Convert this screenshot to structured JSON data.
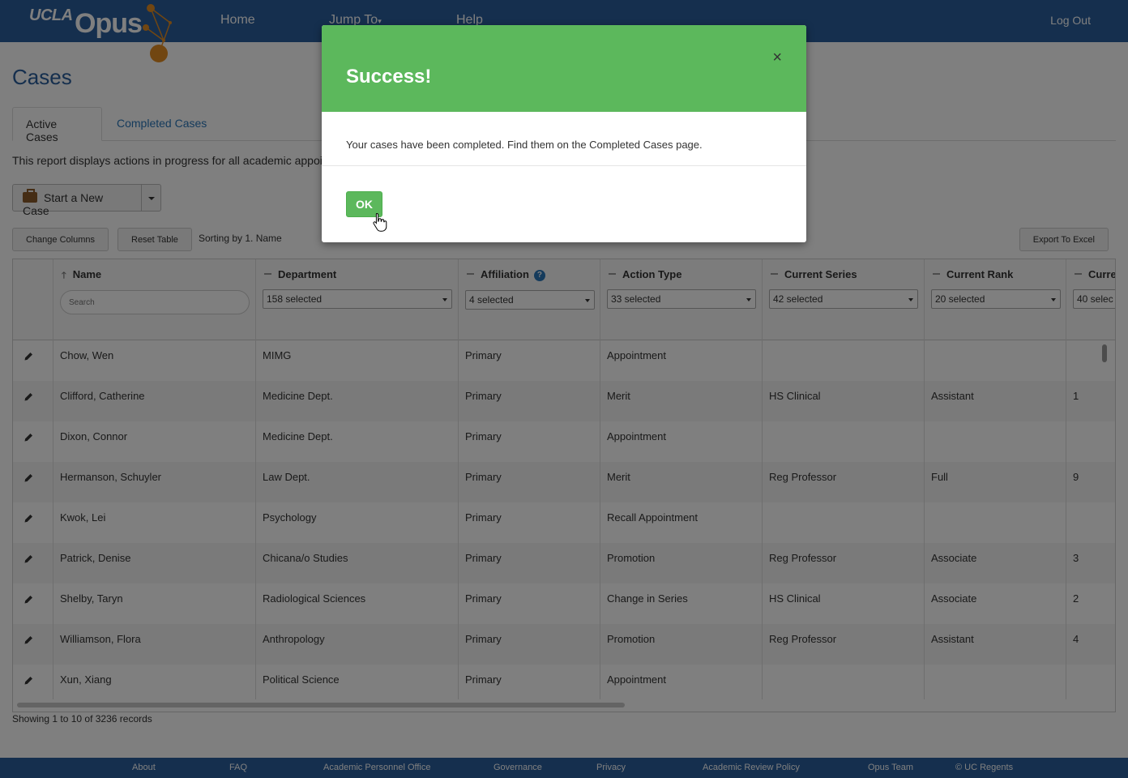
{
  "header": {
    "logo_ucla": "UCLA",
    "logo_opus": "Opus",
    "nav": {
      "home": "Home",
      "jump_to": "Jump To",
      "help": "Help"
    },
    "logout": "Log Out"
  },
  "page": {
    "title": "Cases",
    "tabs": [
      {
        "label": "Active Cases",
        "active": true
      },
      {
        "label": "Completed Cases",
        "active": false
      }
    ],
    "description": "This report displays actions in progress for all academic appoir",
    "start_case_label": "Start a New Case",
    "change_columns_label": "Change Columns",
    "reset_table_label": "Reset Table",
    "sorting_text": "Sorting by 1. Name",
    "export_label": "Export To Excel"
  },
  "table": {
    "columns": [
      {
        "label": "Name",
        "filter_placeholder": "Search"
      },
      {
        "label": "Department",
        "filter": "158 selected"
      },
      {
        "label": "Affiliation",
        "filter": "4 selected"
      },
      {
        "label": "Action Type",
        "filter": "33 selected"
      },
      {
        "label": "Current Series",
        "filter": "42 selected"
      },
      {
        "label": "Current Rank",
        "filter": "20 selected"
      },
      {
        "label": "Curre",
        "filter": "40 selec"
      }
    ],
    "rows": [
      [
        "Chow, Wen",
        "MIMG",
        "Primary",
        "Appointment",
        "",
        "",
        ""
      ],
      [
        "Clifford, Catherine",
        "Medicine Dept.",
        "Primary",
        "Merit",
        "HS Clinical",
        "Assistant",
        "1"
      ],
      [
        "Dixon, Connor",
        "Medicine Dept.",
        "Primary",
        "Appointment",
        "",
        "",
        ""
      ],
      [
        "Hermanson, Schuyler",
        "Law Dept.",
        "Primary",
        "Merit",
        "Reg Professor",
        "Full",
        "9"
      ],
      [
        "Kwok, Lei",
        "Psychology",
        "Primary",
        "Recall Appointment",
        "",
        "",
        ""
      ],
      [
        "Patrick, Denise",
        "Chicana/o Studies",
        "Primary",
        "Promotion",
        "Reg Professor",
        "Associate",
        "3"
      ],
      [
        "Shelby, Taryn",
        "Radiological Sciences",
        "Primary",
        "Change in Series",
        "HS Clinical",
        "Associate",
        "2"
      ],
      [
        "Williamson, Flora",
        "Anthropology",
        "Primary",
        "Promotion",
        "Reg Professor",
        "Assistant",
        "4"
      ],
      [
        "Xun, Xiang",
        "Political Science",
        "Primary",
        "Appointment",
        "",
        "",
        ""
      ]
    ],
    "records_text": "Showing 1 to 10 of 3236 records"
  },
  "footer": {
    "links": [
      "About",
      "FAQ",
      "Academic Personnel Office",
      "Governance",
      "Privacy",
      "Academic Review Policy",
      "Opus Team",
      "© UC Regents"
    ]
  },
  "modal": {
    "title": "Success!",
    "close": "×",
    "message": "Your cases have been completed. Find them on the Completed Cases page.",
    "ok_label": "OK"
  },
  "colors": {
    "brand_blue": "#2a5e9c",
    "success_green": "#5cb85c",
    "link_blue": "#2a76b9",
    "logo_orange": "#e38c22"
  }
}
